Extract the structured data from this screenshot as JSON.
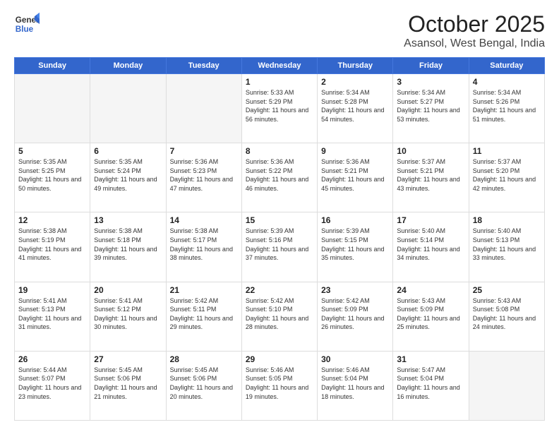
{
  "header": {
    "logo_line1": "General",
    "logo_line2": "Blue",
    "month": "October 2025",
    "location": "Asansol, West Bengal, India"
  },
  "weekdays": [
    "Sunday",
    "Monday",
    "Tuesday",
    "Wednesday",
    "Thursday",
    "Friday",
    "Saturday"
  ],
  "weeks": [
    [
      {
        "day": "",
        "info": ""
      },
      {
        "day": "",
        "info": ""
      },
      {
        "day": "",
        "info": ""
      },
      {
        "day": "1",
        "info": "Sunrise: 5:33 AM\nSunset: 5:29 PM\nDaylight: 11 hours and 56 minutes."
      },
      {
        "day": "2",
        "info": "Sunrise: 5:34 AM\nSunset: 5:28 PM\nDaylight: 11 hours and 54 minutes."
      },
      {
        "day": "3",
        "info": "Sunrise: 5:34 AM\nSunset: 5:27 PM\nDaylight: 11 hours and 53 minutes."
      },
      {
        "day": "4",
        "info": "Sunrise: 5:34 AM\nSunset: 5:26 PM\nDaylight: 11 hours and 51 minutes."
      }
    ],
    [
      {
        "day": "5",
        "info": "Sunrise: 5:35 AM\nSunset: 5:25 PM\nDaylight: 11 hours and 50 minutes."
      },
      {
        "day": "6",
        "info": "Sunrise: 5:35 AM\nSunset: 5:24 PM\nDaylight: 11 hours and 49 minutes."
      },
      {
        "day": "7",
        "info": "Sunrise: 5:36 AM\nSunset: 5:23 PM\nDaylight: 11 hours and 47 minutes."
      },
      {
        "day": "8",
        "info": "Sunrise: 5:36 AM\nSunset: 5:22 PM\nDaylight: 11 hours and 46 minutes."
      },
      {
        "day": "9",
        "info": "Sunrise: 5:36 AM\nSunset: 5:21 PM\nDaylight: 11 hours and 45 minutes."
      },
      {
        "day": "10",
        "info": "Sunrise: 5:37 AM\nSunset: 5:21 PM\nDaylight: 11 hours and 43 minutes."
      },
      {
        "day": "11",
        "info": "Sunrise: 5:37 AM\nSunset: 5:20 PM\nDaylight: 11 hours and 42 minutes."
      }
    ],
    [
      {
        "day": "12",
        "info": "Sunrise: 5:38 AM\nSunset: 5:19 PM\nDaylight: 11 hours and 41 minutes."
      },
      {
        "day": "13",
        "info": "Sunrise: 5:38 AM\nSunset: 5:18 PM\nDaylight: 11 hours and 39 minutes."
      },
      {
        "day": "14",
        "info": "Sunrise: 5:38 AM\nSunset: 5:17 PM\nDaylight: 11 hours and 38 minutes."
      },
      {
        "day": "15",
        "info": "Sunrise: 5:39 AM\nSunset: 5:16 PM\nDaylight: 11 hours and 37 minutes."
      },
      {
        "day": "16",
        "info": "Sunrise: 5:39 AM\nSunset: 5:15 PM\nDaylight: 11 hours and 35 minutes."
      },
      {
        "day": "17",
        "info": "Sunrise: 5:40 AM\nSunset: 5:14 PM\nDaylight: 11 hours and 34 minutes."
      },
      {
        "day": "18",
        "info": "Sunrise: 5:40 AM\nSunset: 5:13 PM\nDaylight: 11 hours and 33 minutes."
      }
    ],
    [
      {
        "day": "19",
        "info": "Sunrise: 5:41 AM\nSunset: 5:13 PM\nDaylight: 11 hours and 31 minutes."
      },
      {
        "day": "20",
        "info": "Sunrise: 5:41 AM\nSunset: 5:12 PM\nDaylight: 11 hours and 30 minutes."
      },
      {
        "day": "21",
        "info": "Sunrise: 5:42 AM\nSunset: 5:11 PM\nDaylight: 11 hours and 29 minutes."
      },
      {
        "day": "22",
        "info": "Sunrise: 5:42 AM\nSunset: 5:10 PM\nDaylight: 11 hours and 28 minutes."
      },
      {
        "day": "23",
        "info": "Sunrise: 5:42 AM\nSunset: 5:09 PM\nDaylight: 11 hours and 26 minutes."
      },
      {
        "day": "24",
        "info": "Sunrise: 5:43 AM\nSunset: 5:09 PM\nDaylight: 11 hours and 25 minutes."
      },
      {
        "day": "25",
        "info": "Sunrise: 5:43 AM\nSunset: 5:08 PM\nDaylight: 11 hours and 24 minutes."
      }
    ],
    [
      {
        "day": "26",
        "info": "Sunrise: 5:44 AM\nSunset: 5:07 PM\nDaylight: 11 hours and 23 minutes."
      },
      {
        "day": "27",
        "info": "Sunrise: 5:45 AM\nSunset: 5:06 PM\nDaylight: 11 hours and 21 minutes."
      },
      {
        "day": "28",
        "info": "Sunrise: 5:45 AM\nSunset: 5:06 PM\nDaylight: 11 hours and 20 minutes."
      },
      {
        "day": "29",
        "info": "Sunrise: 5:46 AM\nSunset: 5:05 PM\nDaylight: 11 hours and 19 minutes."
      },
      {
        "day": "30",
        "info": "Sunrise: 5:46 AM\nSunset: 5:04 PM\nDaylight: 11 hours and 18 minutes."
      },
      {
        "day": "31",
        "info": "Sunrise: 5:47 AM\nSunset: 5:04 PM\nDaylight: 11 hours and 16 minutes."
      },
      {
        "day": "",
        "info": ""
      }
    ]
  ]
}
